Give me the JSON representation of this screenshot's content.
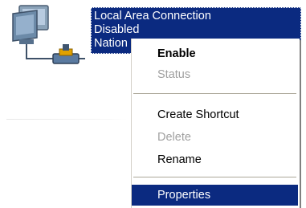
{
  "connection": {
    "name": "Local Area Connection",
    "status": "Disabled",
    "device": "Nation",
    "trailing": "."
  },
  "icon": {
    "name": "network-connection-icon"
  },
  "context_menu": {
    "items": [
      {
        "label": "Enable",
        "state": "default-bold"
      },
      {
        "label": "Status",
        "state": "disabled"
      },
      {
        "label": "Create Shortcut",
        "state": "normal"
      },
      {
        "label": "Delete",
        "state": "disabled"
      },
      {
        "label": "Rename",
        "state": "normal"
      },
      {
        "label": "Properties",
        "state": "selected"
      }
    ]
  },
  "colors": {
    "selection": "#0b2a80",
    "disabled_text": "#a0a0a0",
    "menu_background": "#ffffff"
  }
}
